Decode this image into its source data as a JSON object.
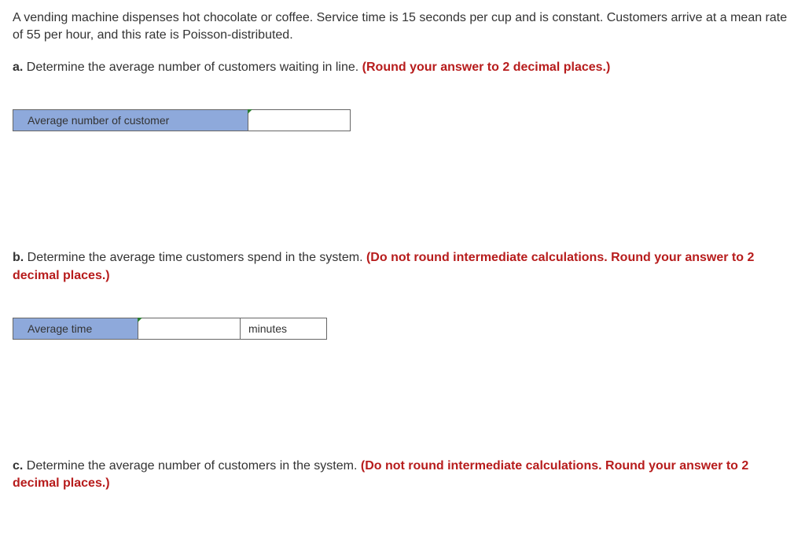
{
  "problem": {
    "intro": "A vending machine dispenses hot chocolate or coffee. Service time is 15 seconds per cup and is constant. Customers arrive at a mean rate of 55 per hour, and this rate is Poisson-distributed."
  },
  "part_a": {
    "label": "a.",
    "text": " Determine the average number of customers waiting in line. ",
    "hint": "(Round your answer to 2 decimal places.)",
    "field_label": "Average number of customer",
    "value": ""
  },
  "part_b": {
    "label": "b.",
    "text": " Determine the average time customers spend in the system. ",
    "hint": "(Do not round intermediate calculations. Round your answer to 2 decimal places.)",
    "field_label": "Average time",
    "value": "",
    "unit": "minutes"
  },
  "part_c": {
    "label": "c.",
    "text": " Determine the average number of customers in the system. ",
    "hint": "(Do not round intermediate calculations. Round your answer to 2 decimal places.)"
  }
}
